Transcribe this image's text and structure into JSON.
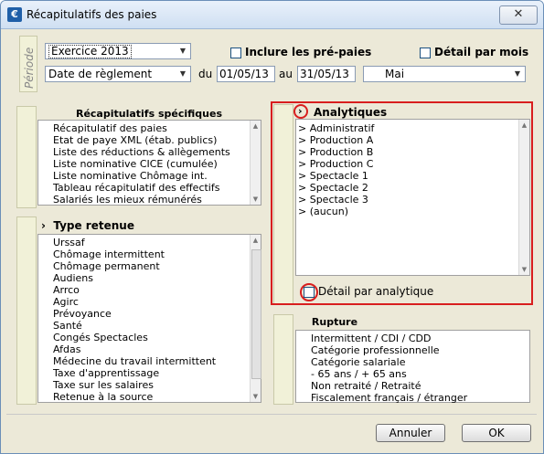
{
  "window": {
    "title": "Récapitulatifs des paies",
    "app_icon": "€",
    "close": "✕"
  },
  "periode": {
    "label": "Période",
    "exercice": "Exercice 2013",
    "date_type": "Date de règlement",
    "du_label": "du",
    "date_from": "01/05/13",
    "au_label": "au",
    "date_to": "31/05/13",
    "month": "Mai",
    "inclure_label": "Inclure les pré-paies",
    "detail_mois_label": "Détail par mois"
  },
  "specifiques": {
    "title": "Récapitulatifs spécifiques",
    "items": [
      "Récapitulatif des paies",
      "Etat de paye XML (étab. publics)",
      "Liste des réductions & allègements",
      "Liste nominative CICE (cumulée)",
      "Liste nominative Chômage int.",
      "Tableau récapitulatif des effectifs",
      "Salariés les mieux rémunérés"
    ]
  },
  "type_retenue": {
    "title": "Type retenue",
    "items": [
      "Urssaf",
      "Chômage intermittent",
      "Chômage permanent",
      "Audiens",
      "Arrco",
      "Agirc",
      "Prévoyance",
      "Santé",
      "Congés Spectacles",
      "Afdas",
      "Médecine du travail intermittent",
      "Taxe d'apprentissage",
      "Taxe sur les salaires",
      "Retenue à la source"
    ]
  },
  "analytiques": {
    "title": "Analytiques",
    "items": [
      "Administratif",
      "Production A",
      "Production B",
      "Production C",
      "Spectacle 1",
      "Spectacle 2",
      "Spectacle 3",
      "(aucun)"
    ],
    "detail_label": "Détail par analytique"
  },
  "rupture": {
    "title": "Rupture",
    "items": [
      "Intermittent / CDI / CDD",
      "Catégorie professionnelle",
      "Catégorie salariale",
      "- 65 ans / + 65 ans",
      "Non retraité / Retraité",
      "Fiscalement français / étranger"
    ]
  },
  "buttons": {
    "cancel": "Annuler",
    "ok": "OK"
  },
  "colors": {
    "highlight": "#d81e1e",
    "tab_bg": "#f1f1d8"
  }
}
